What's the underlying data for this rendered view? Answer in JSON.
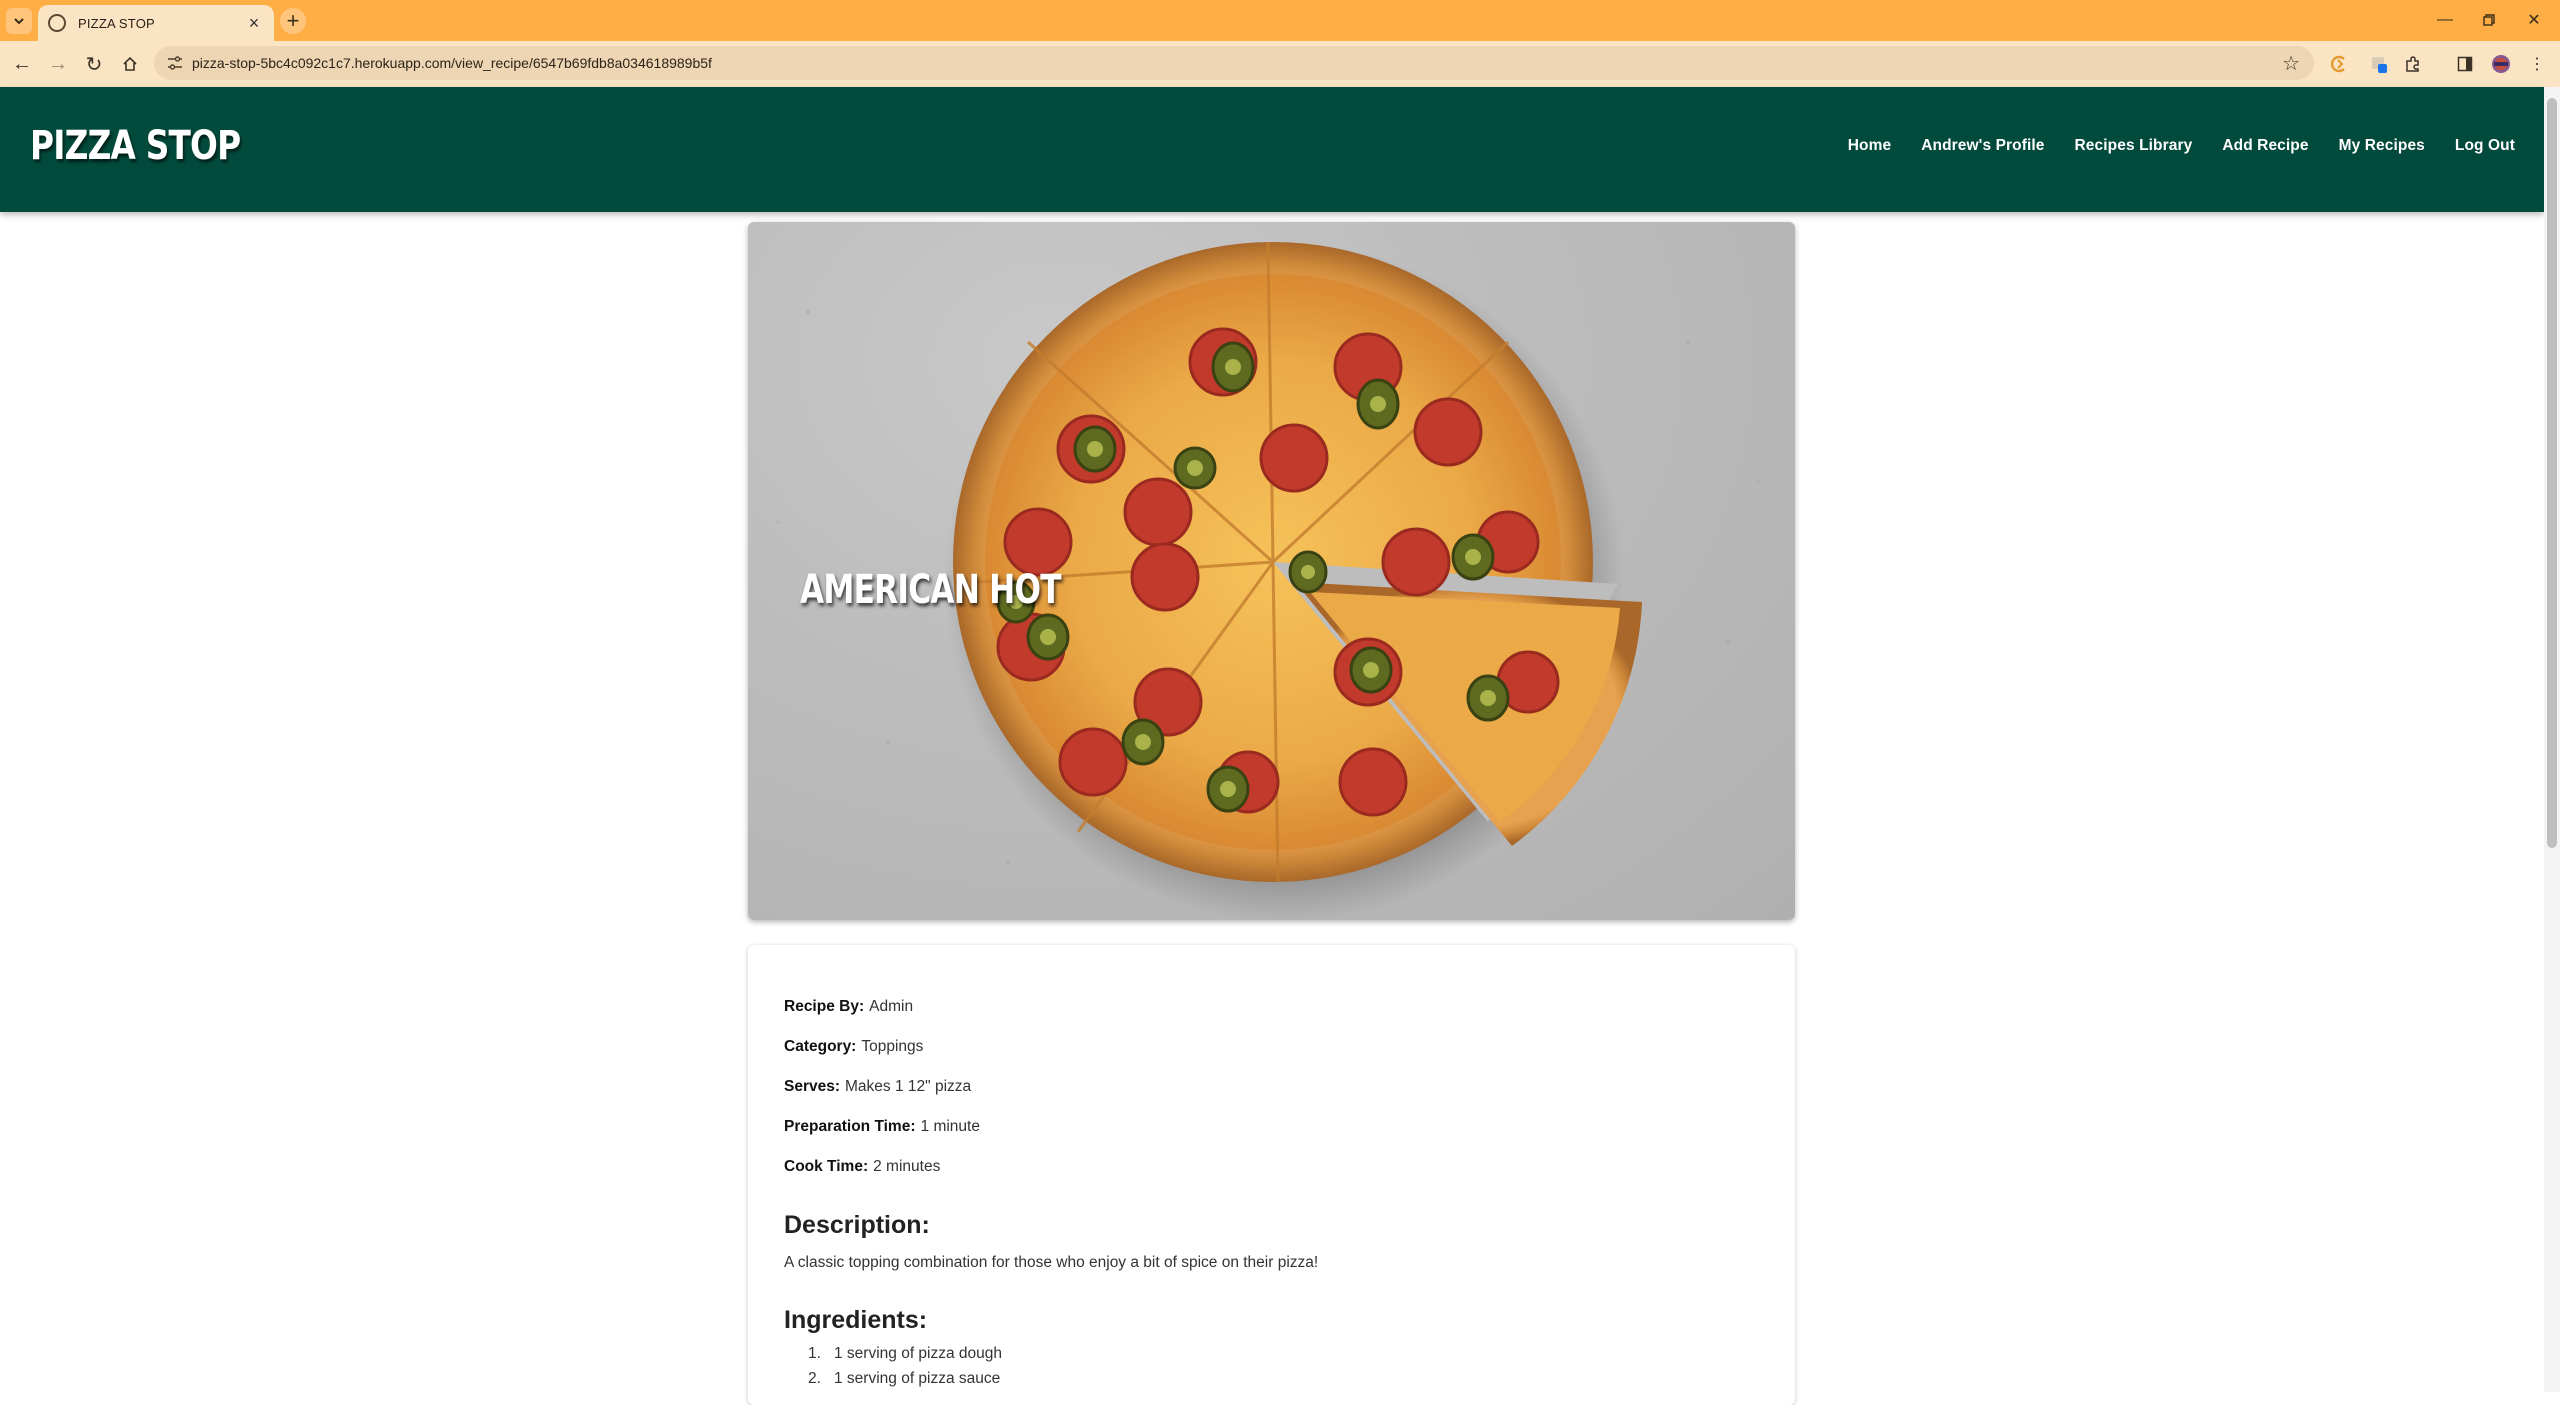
{
  "browser": {
    "tab_title": "PIZZA STOP",
    "url_host": "pizza-stop-5bc4c092c1c7.herokuapp.com",
    "url_path": "/view_recipe/6547b69fdb8a034618989b5f"
  },
  "site": {
    "brand": "PIZZA STOP",
    "nav": [
      "Home",
      "Andrew's Profile",
      "Recipes Library",
      "Add Recipe",
      "My Recipes",
      "Log Out"
    ]
  },
  "recipe": {
    "title": "AMERICAN HOT",
    "meta": [
      {
        "label": "Recipe By:",
        "value": "Admin"
      },
      {
        "label": "Category:",
        "value": "Toppings"
      },
      {
        "label": "Serves:",
        "value": "Makes 1 12\" pizza"
      },
      {
        "label": "Preparation Time:",
        "value": "1 minute"
      },
      {
        "label": "Cook Time:",
        "value": "2 minutes"
      }
    ],
    "description_heading": "Description:",
    "description": "A classic topping combination for those who enjoy a bit of spice on their pizza!",
    "ingredients_heading": "Ingredients:",
    "ingredients": [
      {
        "num": "1.",
        "text": "1 serving of pizza dough"
      },
      {
        "num": "2.",
        "text": "1 serving of pizza sauce"
      }
    ]
  },
  "colors": {
    "tabstrip": "#ffae45",
    "navbar": "#024a3b"
  }
}
